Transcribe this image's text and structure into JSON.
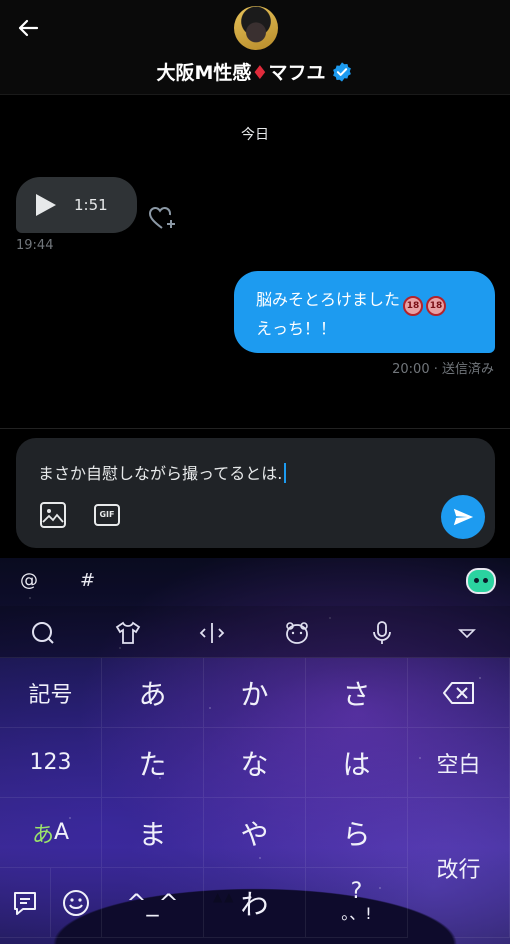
{
  "header": {
    "back_icon": "arrow-left-icon",
    "name_part1": "大阪M性感",
    "diamond": "♦",
    "name_part2": "マフユ",
    "verified_icon": "verified-badge-icon",
    "accent": "#1d9bf0"
  },
  "chat": {
    "date_separator": "今日",
    "voice_message": {
      "duration": "1:51",
      "time": "19:44"
    },
    "sent_message": {
      "line1": "脳みそとろけました",
      "badge1": "18",
      "badge2": "18",
      "line2": "えっち！！",
      "status": "20:00 · 送信済み"
    }
  },
  "composer": {
    "text": "まさか自慰しながら撮ってるとは.",
    "gif_label": "GIF"
  },
  "keyboard": {
    "top_row": {
      "at": "@",
      "hash": "#"
    },
    "tools": [
      "search-icon",
      "shirt-icon",
      "cursor-icon",
      "bear-face-icon",
      "mic-icon",
      "collapse-icon"
    ],
    "keys": {
      "kigou": "記号",
      "a": "あ",
      "ka": "か",
      "sa": "さ",
      "n123": "123",
      "ta": "た",
      "na": "な",
      "ha": "は",
      "space": "空白",
      "aA_a": "あ",
      "aA_A": "A",
      "ma": "ま",
      "ya": "や",
      "ra": "ら",
      "enter": "改行",
      "kaomoji": "^_^",
      "wa": "わ",
      "punct_top": "?",
      "punct_bottom": "。、!"
    }
  }
}
